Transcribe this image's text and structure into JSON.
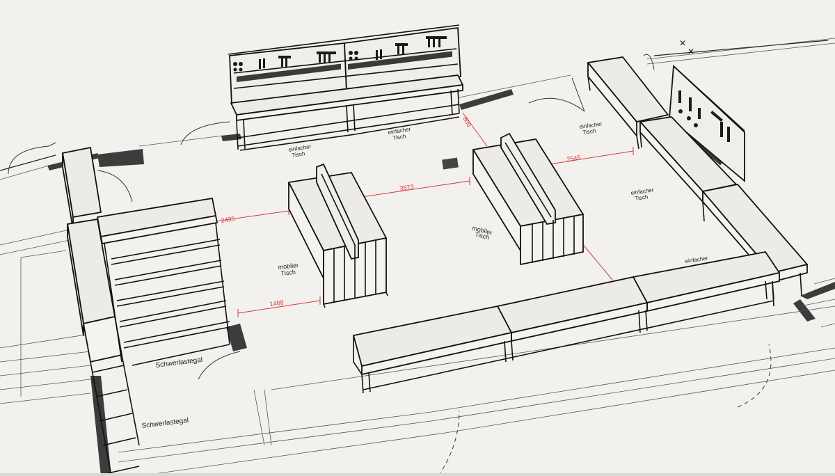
{
  "labels": {
    "einfacher_tisch_1": [
      "einfacher",
      "Tisch"
    ],
    "einfacher_tisch_2": [
      "einfacher",
      "Tisch"
    ],
    "einfacher_tisch_3": [
      "einfacher",
      "Tisch"
    ],
    "einfacher_tisch_4": [
      "einfacher",
      "Tisch"
    ],
    "einfacher_tisch_5": [
      "einfacher"
    ],
    "mobiler_tisch_1": [
      "mobiler",
      "Tisch"
    ],
    "mobiler_tisch_2": [
      "mobiler",
      "Tisch"
    ],
    "schwerlastegal_1": "Schwerlastegal",
    "schwerlastegal_2": "Schwerlastegal"
  },
  "dimensions": {
    "d1": "2435",
    "d2": "3573",
    "d3": "2545",
    "d4": "1488",
    "d5": "800"
  }
}
